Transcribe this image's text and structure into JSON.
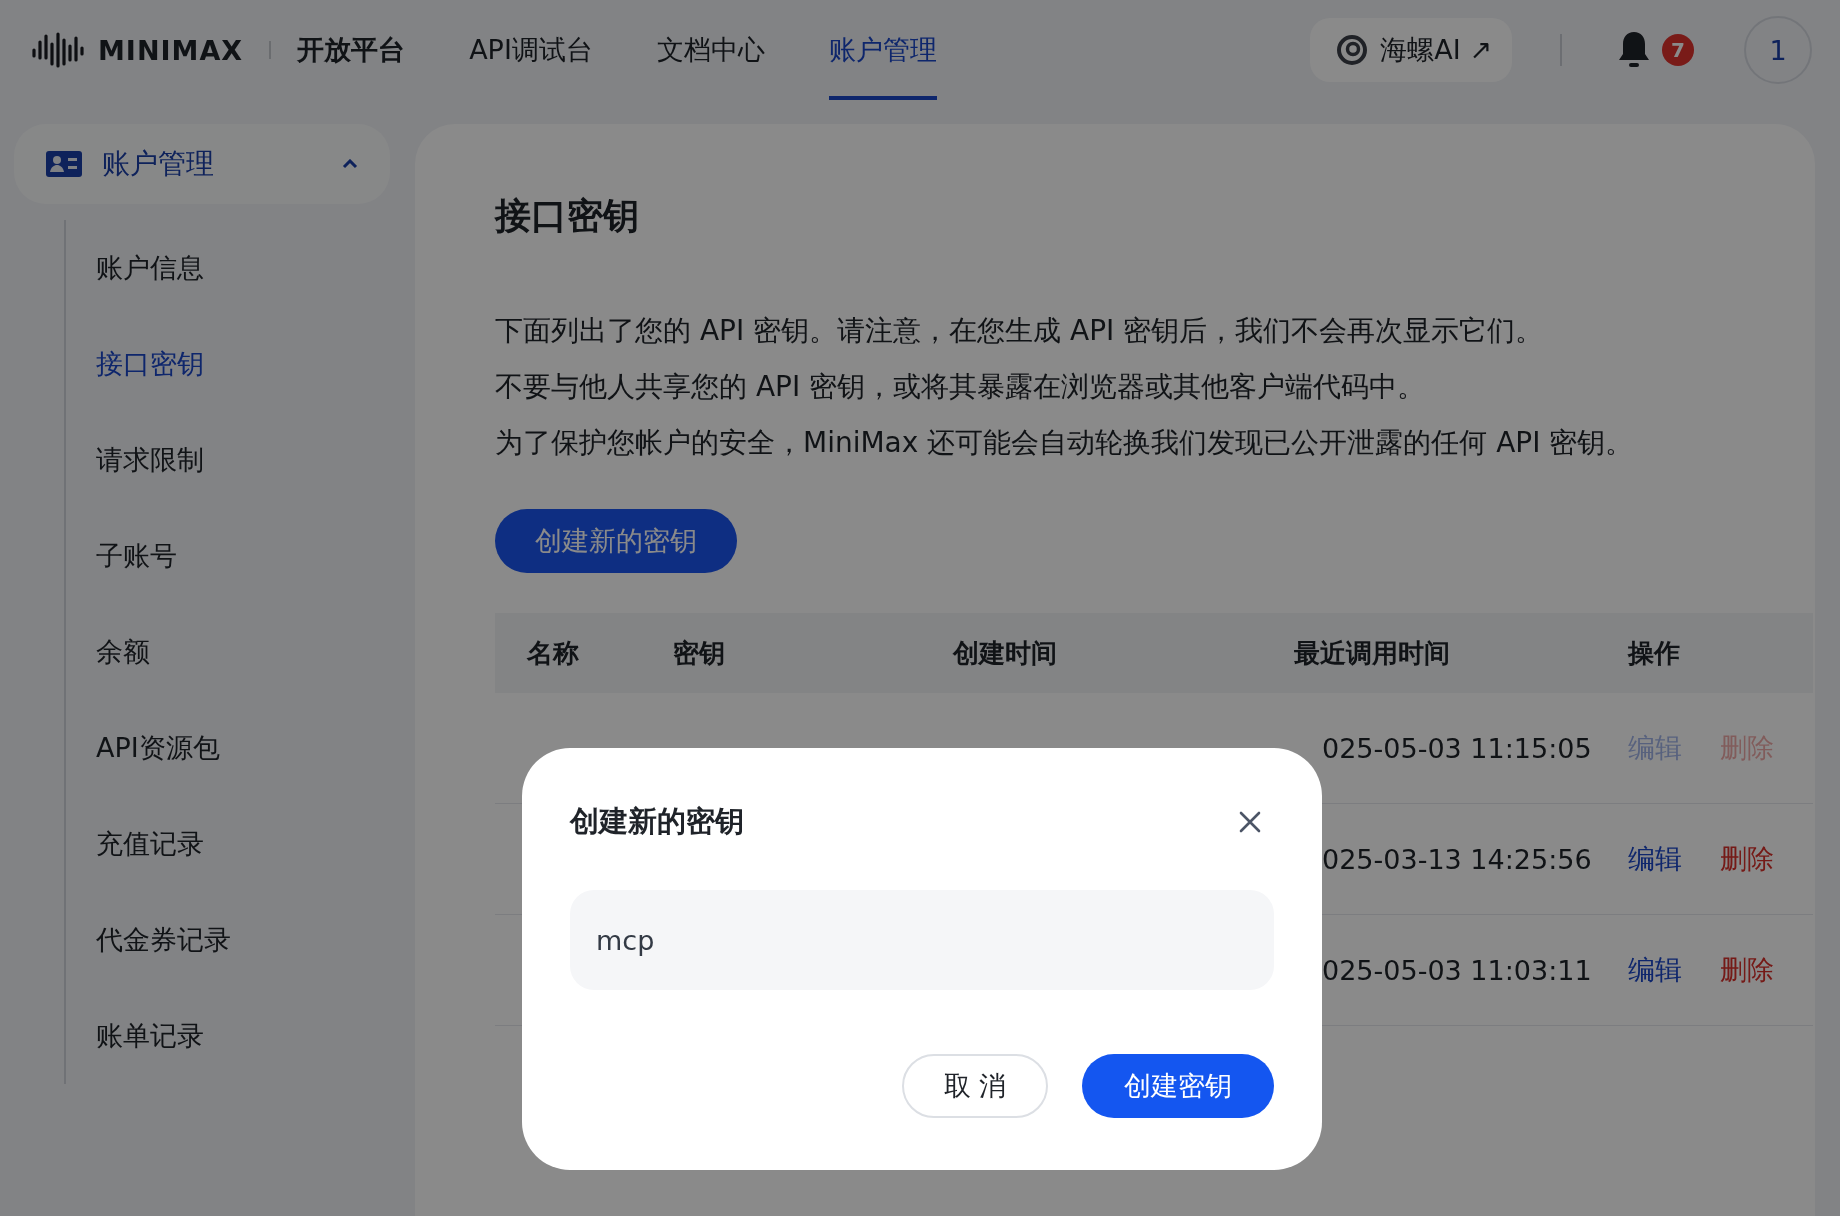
{
  "header": {
    "logo_text": "MINIMAX",
    "platform_title": "开放平台",
    "nav": [
      {
        "label": "API调试台",
        "selected": false
      },
      {
        "label": "文档中心",
        "selected": false
      },
      {
        "label": "账户管理",
        "selected": true
      }
    ],
    "app_link": {
      "label": "海螺AI",
      "arrow": "↗"
    },
    "notifications": {
      "count": "7"
    },
    "avatar": {
      "label": "1"
    }
  },
  "sidebar": {
    "group": {
      "label": "账户管理",
      "expanded": true
    },
    "items": [
      {
        "label": "账户信息",
        "selected": false
      },
      {
        "label": "接口密钥",
        "selected": true
      },
      {
        "label": "请求限制",
        "selected": false
      },
      {
        "label": "子账号",
        "selected": false
      },
      {
        "label": "余额",
        "selected": false
      },
      {
        "label": "API资源包",
        "selected": false
      },
      {
        "label": "充值记录",
        "selected": false
      },
      {
        "label": "代金券记录",
        "selected": false
      },
      {
        "label": "账单记录",
        "selected": false
      }
    ]
  },
  "main": {
    "title": "接口密钥",
    "paragraphs": [
      "下面列出了您的 API 密钥。请注意，在您生成 API 密钥后，我们不会再次显示它们。",
      "不要与他人共享您的 API 密钥，或将其暴露在浏览器或其他客户端代码中。",
      "为了保护您帐户的安全，MiniMax 还可能会自动轮换我们发现已公开泄露的任何 API 密钥。"
    ],
    "create_button": "创建新的密钥",
    "table": {
      "columns": [
        "名称",
        "密钥",
        "创建时间",
        "最近调用时间",
        "操作"
      ],
      "rows": [
        {
          "last_used": "025-05-03 11:15:05",
          "disabled": true,
          "actions": [
            {
              "label": "编辑",
              "kind": "edit"
            },
            {
              "label": "删除",
              "kind": "delete"
            }
          ]
        },
        {
          "last_used": "025-03-13 14:25:56",
          "disabled": false,
          "actions": [
            {
              "label": "编辑",
              "kind": "edit"
            },
            {
              "label": "删除",
              "kind": "delete"
            }
          ]
        },
        {
          "last_used": "025-05-03 11:03:11",
          "disabled": false,
          "actions": [
            {
              "label": "编辑",
              "kind": "edit"
            },
            {
              "label": "删除",
              "kind": "delete"
            }
          ]
        }
      ]
    }
  },
  "dialog": {
    "title": "创建新的密钥",
    "input": {
      "value": "mcp"
    },
    "buttons": [
      {
        "label": "取 消",
        "kind": "secondary"
      },
      {
        "label": "创建密钥",
        "kind": "primary"
      }
    ]
  }
}
